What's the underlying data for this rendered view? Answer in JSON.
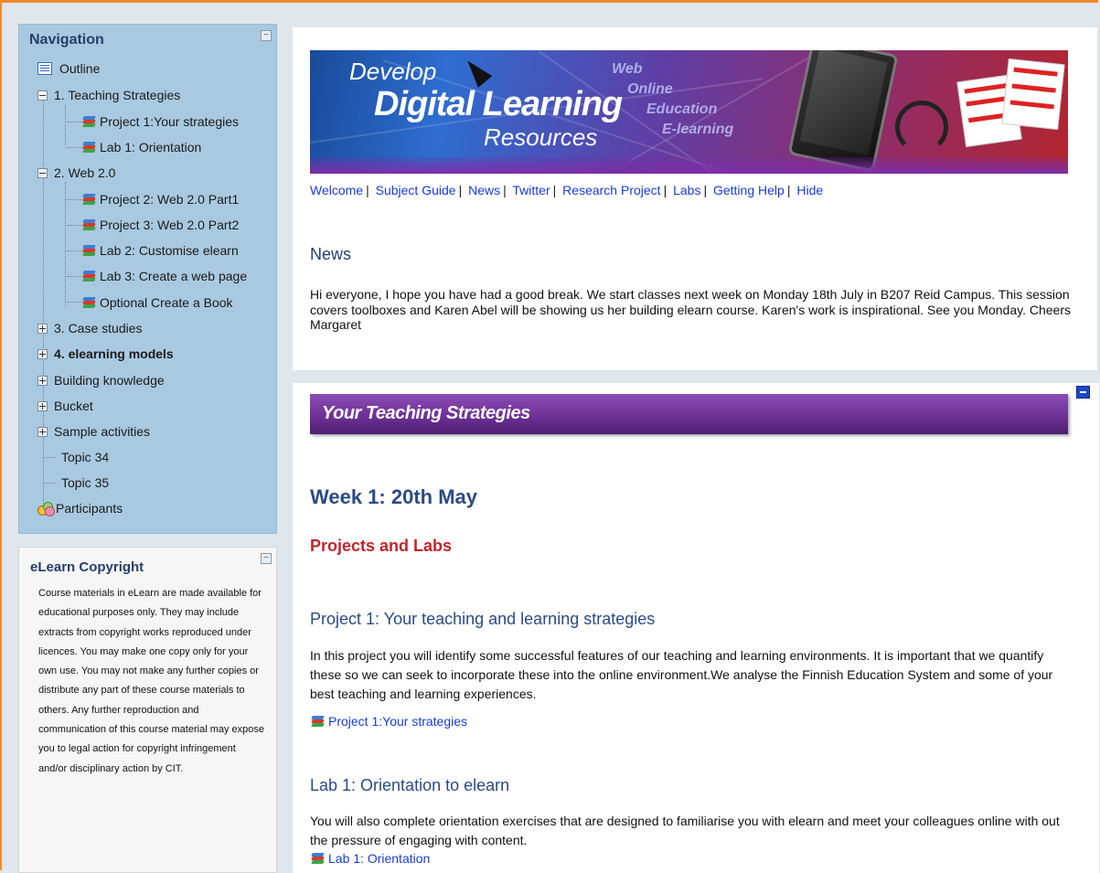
{
  "navigation": {
    "title": "Navigation",
    "items": [
      {
        "label": "Outline",
        "icon": "outline-icon"
      },
      {
        "label": "1. Teaching Strategies",
        "expander": "minus"
      },
      {
        "label": "Project 1:Your strategies",
        "icon": "book-icon"
      },
      {
        "label": "Lab 1: Orientation",
        "icon": "book-icon"
      },
      {
        "label": "2. Web 2.0",
        "expander": "minus"
      },
      {
        "label": "Project 2: Web 2.0 Part1",
        "icon": "book-icon"
      },
      {
        "label": "Project 3: Web 2.0 Part2",
        "icon": "book-icon"
      },
      {
        "label": "Lab 2: Customise elearn",
        "icon": "book-icon"
      },
      {
        "label": "Lab 3: Create a web page",
        "icon": "book-icon"
      },
      {
        "label": "Optional Create a Book",
        "icon": "book-icon"
      },
      {
        "label": "3. Case studies",
        "expander": "plus"
      },
      {
        "label": "4. elearning models",
        "expander": "plus",
        "bold": true
      },
      {
        "label": "Building knowledge",
        "expander": "plus"
      },
      {
        "label": "Bucket",
        "expander": "plus"
      },
      {
        "label": "Sample activities",
        "expander": "plus"
      },
      {
        "label": "Topic 34"
      },
      {
        "label": "Topic 35"
      },
      {
        "label": "Participants",
        "icon": "participants-icon"
      }
    ]
  },
  "copyright": {
    "title": "eLearn Copyright",
    "text": "Course materials in eLearn are made available for educational purposes only. They may include extracts from copyright works reproduced under licences. You may make one copy only for your own use. You may not make any further copies or distribute any part of these course materials to others. Any further reproduction and communication of this course material may expose you to legal action for copyright infringement and/or disciplinary action by CIT."
  },
  "banner": {
    "develop": "Develop",
    "digital": "Digital Learning",
    "resources": "Resources",
    "words": [
      "Web",
      "Online",
      "Education",
      "E-learning"
    ]
  },
  "linkbar": [
    "Welcome",
    "Subject Guide",
    "News",
    "Twitter",
    "Research Project",
    "Labs",
    "Getting Help",
    "Hide"
  ],
  "news": {
    "heading": "News",
    "text": "Hi everyone, I hope you have had a good break. We start classes next week on Monday 18th July in B207 Reid Campus. This session covers toolboxes and Karen Abel will be showing us her building elearn course. Karen's work is inspirational. See you Monday. Cheers Margaret"
  },
  "section": {
    "banner_title": "Your Teaching Strategies",
    "week": "Week 1: 20th May",
    "projects_and_labs": "Projects and Labs",
    "project_heading": "Project 1: Your teaching and learning strategies",
    "project_text": "In this project you will identify some successful features of our teaching and learning environments. It is important that we quantify these so we can seek to incorporate these into the online environment.We analyse the Finnish Education System and some of your best teaching and learning experiences.",
    "project_link": "Project 1:Your strategies",
    "lab_heading": "Lab 1: Orientation to elearn",
    "lab_text": "You will also complete orientation exercises that are designed to familiarise you with elearn and meet your colleagues online with out the pressure of engaging with content.",
    "lab_link": "Lab 1: Orientation"
  },
  "colors": {
    "accent_border": "#f08a2b",
    "nav_bg": "#a9c9e0",
    "heading_blue": "#2c4a84",
    "heading_red": "#c0262c",
    "link_blue": "#1a3bd6",
    "section_banner": "#6a2f93"
  }
}
